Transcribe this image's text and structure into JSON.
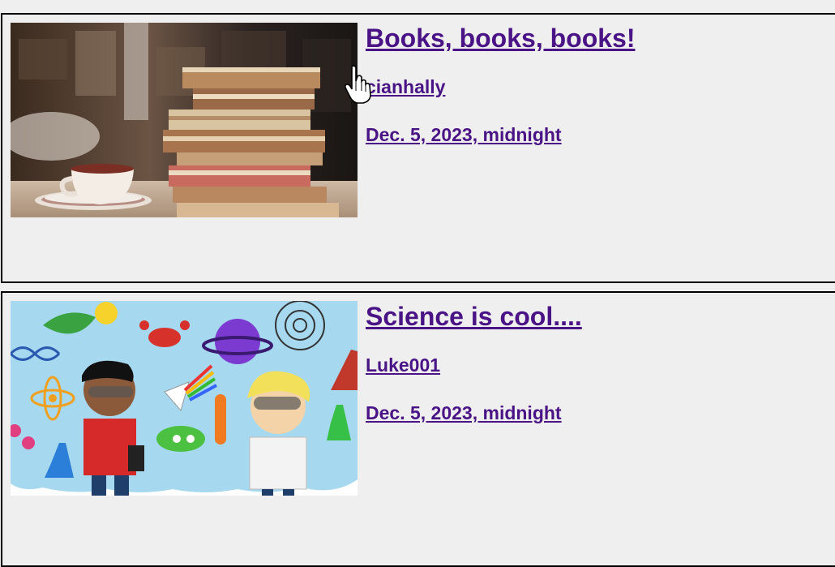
{
  "posts": [
    {
      "title": "Books, books, books!",
      "author": "cianhally",
      "date": "Dec. 5, 2023, midnight",
      "image": "stack-of-books-with-coffee-cup"
    },
    {
      "title": "Science is cool....",
      "author": "Luke001",
      "date": "Dec. 5, 2023, midnight",
      "image": "cartoon-kids-science-illustration"
    }
  ],
  "colors": {
    "link": "#4a1486",
    "background": "#efefef",
    "border": "#000000"
  }
}
